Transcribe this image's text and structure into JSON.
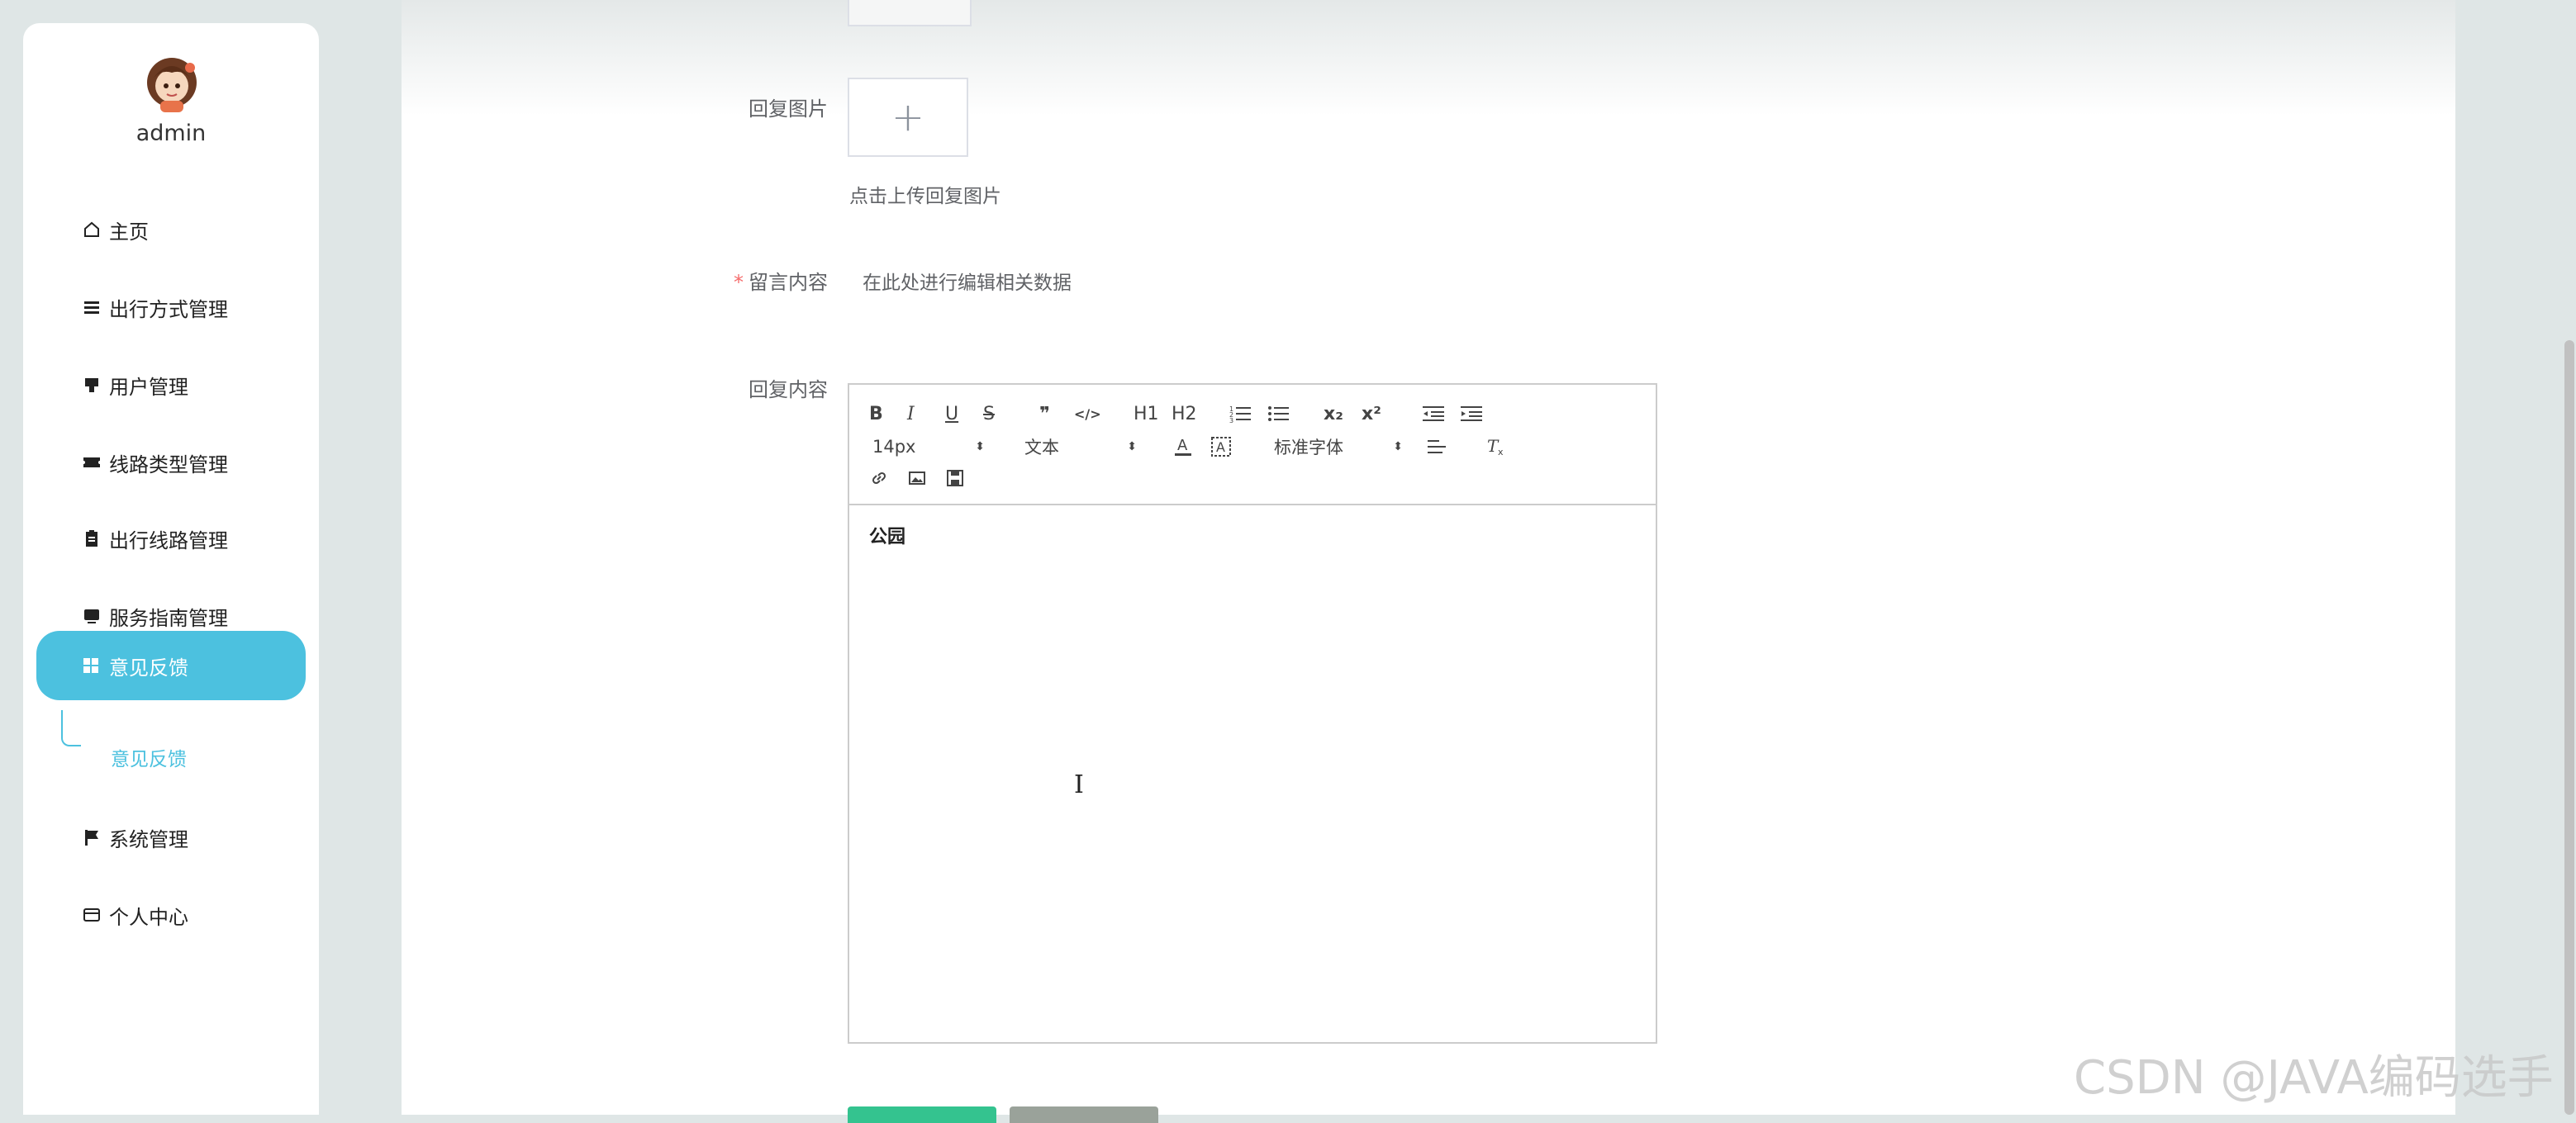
{
  "user": {
    "name": "admin"
  },
  "sidebar": {
    "items": [
      {
        "label": "主页",
        "icon": "home-icon"
      },
      {
        "label": "出行方式管理",
        "icon": "list-icon"
      },
      {
        "label": "用户管理",
        "icon": "user-icon"
      },
      {
        "label": "线路类型管理",
        "icon": "ticket-icon"
      },
      {
        "label": "出行线路管理",
        "icon": "clipboard-icon"
      },
      {
        "label": "服务指南管理",
        "icon": "monitor-icon"
      },
      {
        "label": "意见反馈",
        "icon": "grid-icon",
        "active": true
      },
      {
        "label": "系统管理",
        "icon": "flag-icon"
      },
      {
        "label": "个人中心",
        "icon": "card-icon"
      }
    ],
    "submenu": {
      "label": "意见反馈"
    }
  },
  "form": {
    "reply_image_label": "回复图片",
    "upload_plus": "+",
    "upload_tip": "点击上传回复图片",
    "message_label": "留言内容",
    "required_mark": "*",
    "message_value": "在此处进行编辑相关数据",
    "reply_content_label": "回复内容"
  },
  "editor": {
    "font_size": "14px",
    "header_select": "文本",
    "font_family": "标准字体",
    "content": "公园",
    "buttons": [
      "B",
      "I",
      "U",
      "S",
      "❞",
      "</>",
      "H1",
      "H2",
      "ordered-list",
      "bullet-list",
      "x₂",
      "x²",
      "outdent",
      "indent"
    ]
  },
  "watermark": "CSDN @JAVA编码选手",
  "colors": {
    "accent": "#4cc1df",
    "primary_button": "#34c38f",
    "secondary_button": "#9aa29a",
    "required": "#f56c6c"
  }
}
